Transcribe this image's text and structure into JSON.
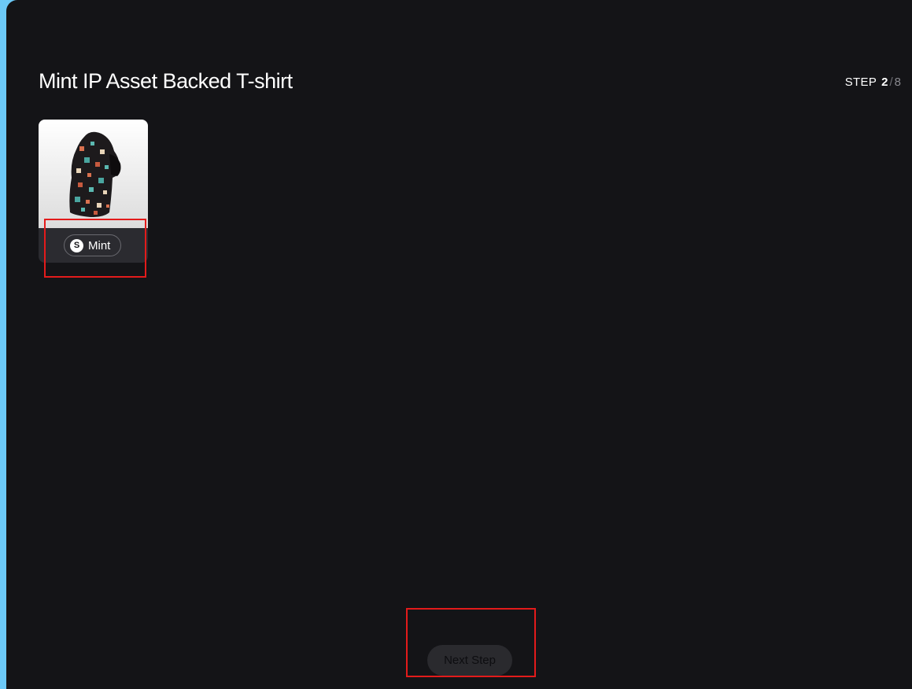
{
  "page": {
    "title": "Mint IP Asset Backed T-shirt"
  },
  "step": {
    "label": "STEP",
    "current": "2",
    "separator": "/",
    "total": "8"
  },
  "card": {
    "image_alt": "T-shirt",
    "mint_icon_glyph": "S",
    "mint_label": "Mint"
  },
  "footer": {
    "next_label": "Next Step"
  },
  "colors": {
    "accent_edge": "#6cc9f7",
    "background": "#141417",
    "highlight": "#e31b1b"
  }
}
